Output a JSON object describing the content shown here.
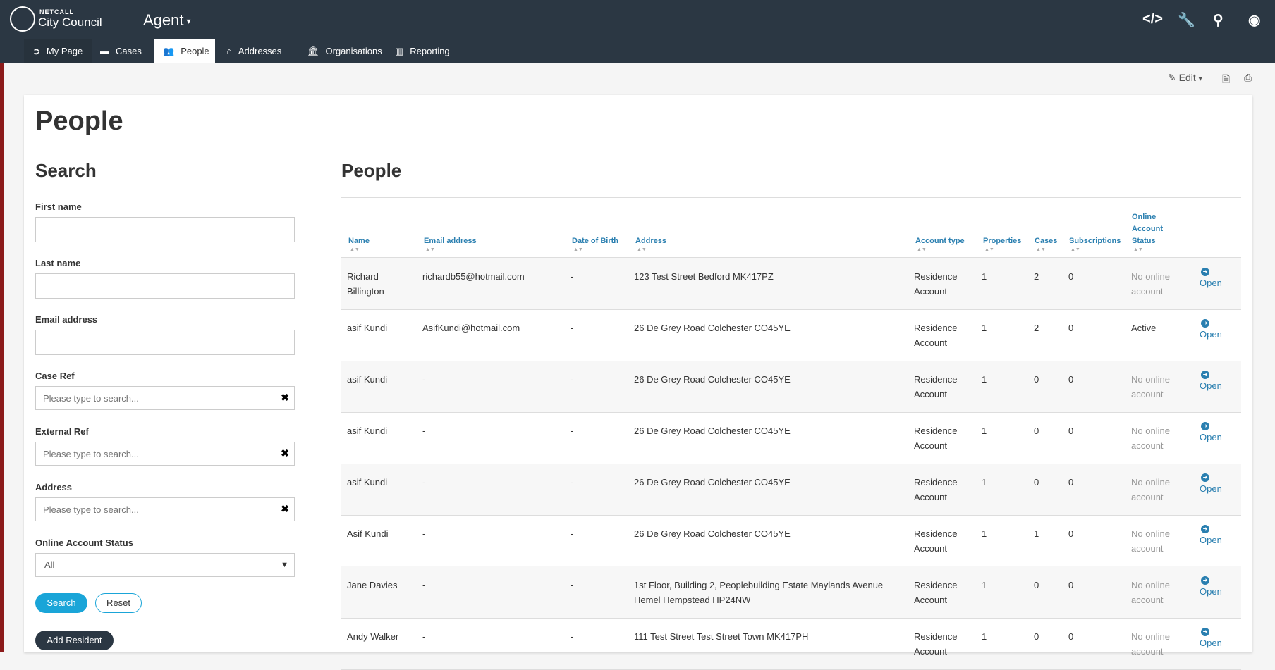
{
  "header": {
    "brand_small": "NETCALL",
    "brand_large": "City Council",
    "app_name": "Agent",
    "icons": [
      "code-icon",
      "wrench-icon",
      "search-icon",
      "user-icon"
    ]
  },
  "nav": {
    "tabs": [
      {
        "label": "My Page",
        "icon": "arrow-circle-icon"
      },
      {
        "label": "Cases",
        "icon": "folder-icon"
      },
      {
        "label": "People",
        "icon": "users-icon"
      },
      {
        "label": "Addresses",
        "icon": "home-icon"
      },
      {
        "label": "Organisations",
        "icon": "bank-icon"
      },
      {
        "label": "Reporting",
        "icon": "bar-chart-icon"
      }
    ]
  },
  "page_tools": {
    "edit_label": "Edit"
  },
  "page": {
    "title": "People"
  },
  "search": {
    "heading": "Search",
    "first_name_label": "First name",
    "last_name_label": "Last name",
    "email_label": "Email address",
    "case_ref_label": "Case Ref",
    "case_ref_placeholder": "Please type to search...",
    "external_ref_label": "External Ref",
    "external_ref_placeholder": "Please type to search...",
    "address_label": "Address",
    "address_placeholder": "Please type to search...",
    "status_label": "Online Account Status",
    "status_value": "All",
    "search_button": "Search",
    "reset_button": "Reset",
    "add_button": "Add Resident"
  },
  "table": {
    "heading": "People",
    "columns": {
      "name": "Name",
      "email": "Email address",
      "dob": "Date of Birth",
      "address": "Address",
      "account_type": "Account type",
      "properties": "Properties",
      "cases": "Cases",
      "subscriptions": "Subscriptions",
      "status_line1": "Online",
      "status_line2": "Account",
      "status_line3": "Status"
    },
    "open_label": "Open",
    "rows": [
      {
        "name1": "Richard",
        "name2": "Billington",
        "email": "richardb55@hotmail.com",
        "dob": "-",
        "address1": "123 Test Street Bedford MK417PZ",
        "address2": "",
        "type1": "Residence",
        "type2": "Account",
        "properties": "1",
        "cases": "2",
        "subscriptions": "0",
        "status1": "No online",
        "status2": "account"
      },
      {
        "name1": "asif Kundi",
        "name2": "",
        "email": "AsifKundi@hotmail.com",
        "dob": "-",
        "address1": "26 De Grey Road Colchester CO45YE",
        "address2": "",
        "type1": "Residence",
        "type2": "Account",
        "properties": "1",
        "cases": "2",
        "subscriptions": "0",
        "status1": "Active",
        "status2": ""
      },
      {
        "name1": "asif Kundi",
        "name2": "",
        "email": "-",
        "dob": "-",
        "address1": "26 De Grey Road Colchester CO45YE",
        "address2": "",
        "type1": "Residence",
        "type2": "Account",
        "properties": "1",
        "cases": "0",
        "subscriptions": "0",
        "status1": "No online",
        "status2": "account"
      },
      {
        "name1": "asif Kundi",
        "name2": "",
        "email": "-",
        "dob": "-",
        "address1": "26 De Grey Road Colchester CO45YE",
        "address2": "",
        "type1": "Residence",
        "type2": "Account",
        "properties": "1",
        "cases": "0",
        "subscriptions": "0",
        "status1": "No online",
        "status2": "account"
      },
      {
        "name1": "asif Kundi",
        "name2": "",
        "email": "-",
        "dob": "-",
        "address1": "26 De Grey Road Colchester CO45YE",
        "address2": "",
        "type1": "Residence",
        "type2": "Account",
        "properties": "1",
        "cases": "0",
        "subscriptions": "0",
        "status1": "No online",
        "status2": "account"
      },
      {
        "name1": "Asif Kundi",
        "name2": "",
        "email": "-",
        "dob": "-",
        "address1": "26 De Grey Road Colchester CO45YE",
        "address2": "",
        "type1": "Residence",
        "type2": "Account",
        "properties": "1",
        "cases": "1",
        "subscriptions": "0",
        "status1": "No online",
        "status2": "account"
      },
      {
        "name1": "Jane Davies",
        "name2": "",
        "email": "-",
        "dob": "-",
        "address1": "1st Floor, Building 2, Peoplebuilding Estate Maylands Avenue",
        "address2": "Hemel Hempstead HP24NW",
        "type1": "Residence",
        "type2": "Account",
        "properties": "1",
        "cases": "0",
        "subscriptions": "0",
        "status1": "No online",
        "status2": "account"
      },
      {
        "name1": "Andy Walker",
        "name2": "",
        "email": "-",
        "dob": "-",
        "address1": "111 Test Street Test Street Town MK417PH",
        "address2": "",
        "type1": "Residence",
        "type2": "Account",
        "properties": "1",
        "cases": "0",
        "subscriptions": "0",
        "status1": "No online",
        "status2": "account"
      }
    ]
  }
}
